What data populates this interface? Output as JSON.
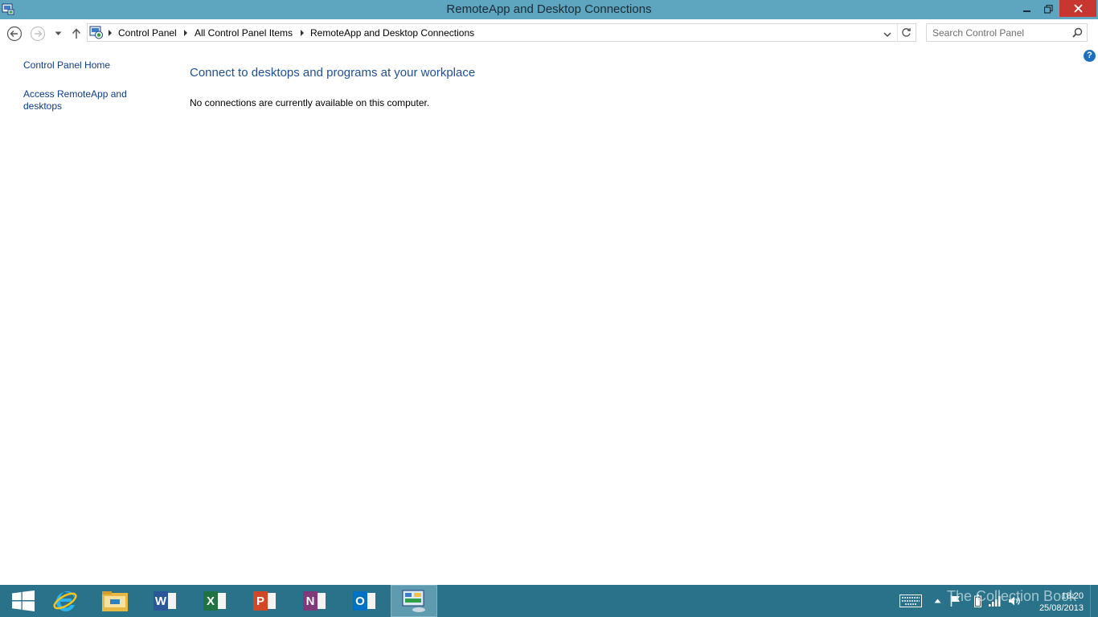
{
  "window": {
    "title": "RemoteApp and Desktop Connections"
  },
  "breadcrumb": [
    "Control Panel",
    "All Control Panel Items",
    "RemoteApp and Desktop Connections"
  ],
  "search": {
    "placeholder": "Search Control Panel"
  },
  "help_label": "?",
  "left_pane": {
    "home_link": "Control Panel Home",
    "access_link": "Access RemoteApp and desktops"
  },
  "main": {
    "heading": "Connect to desktops and programs at your workplace",
    "status_text": "No connections are currently available on this computer."
  },
  "taskbar": {
    "apps": [
      {
        "name": "Internet Explorer",
        "icon": "internet-explorer-icon"
      },
      {
        "name": "File Explorer",
        "icon": "file-explorer-icon"
      },
      {
        "name": "Word",
        "letter": "W",
        "color": "#2b579a"
      },
      {
        "name": "Excel",
        "letter": "X",
        "color": "#217346"
      },
      {
        "name": "PowerPoint",
        "letter": "P",
        "color": "#d24726"
      },
      {
        "name": "OneNote",
        "letter": "N",
        "color": "#80397b"
      },
      {
        "name": "Outlook",
        "letter": "O",
        "color": "#0072c6"
      }
    ],
    "active_app": "Control Panel"
  },
  "watermark": "The Collection Book",
  "clock": {
    "time": "18:20",
    "date": "25/08/2013"
  },
  "colors": {
    "titlebar": "#5ea6c0",
    "close": "#c7372f",
    "taskbar": "#2a7289",
    "link": "#0d3b8a",
    "heading": "#1e4f9a"
  }
}
